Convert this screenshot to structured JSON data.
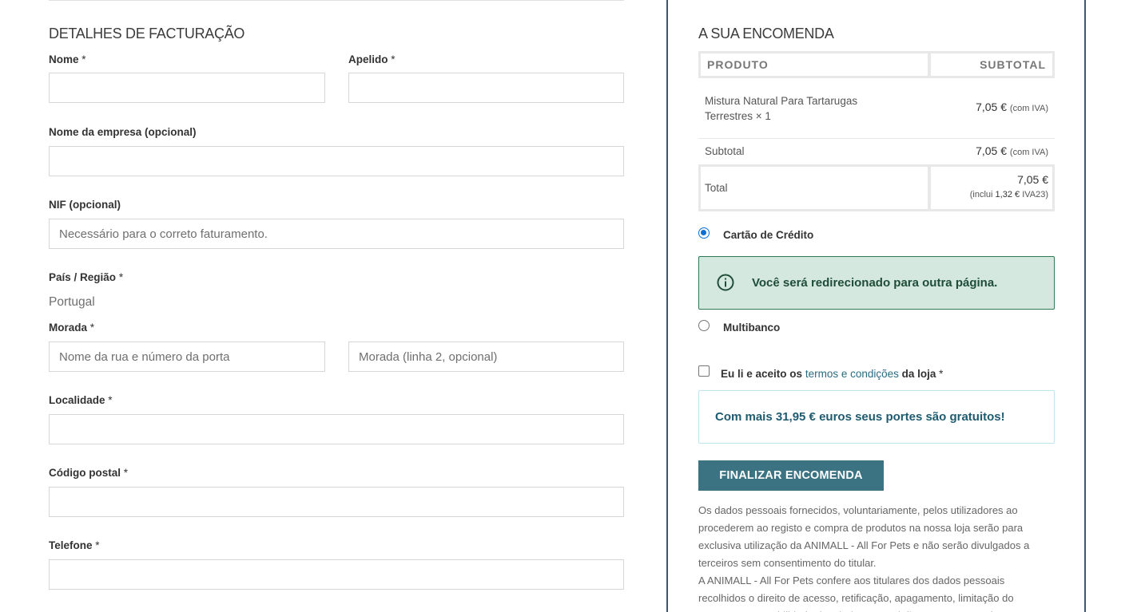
{
  "billing": {
    "title": "DETALHES DE FACTURAÇÃO",
    "required_mark": "*",
    "fields": {
      "first_name": {
        "label": "Nome",
        "value": "",
        "placeholder": ""
      },
      "last_name": {
        "label": "Apelido",
        "value": "",
        "placeholder": ""
      },
      "company": {
        "label": "Nome da empresa (opcional)",
        "value": "",
        "placeholder": ""
      },
      "nif": {
        "label": "NIF (opcional)",
        "value": "",
        "placeholder": "Necessário para o correto faturamento."
      },
      "country": {
        "label": "País / Região",
        "value": "Portugal"
      },
      "address1": {
        "label": "Morada",
        "value": "",
        "placeholder": "Nome da rua e número da porta"
      },
      "address2": {
        "value": "",
        "placeholder": "Morada (linha 2, opcional)"
      },
      "city": {
        "label": "Localidade",
        "value": "",
        "placeholder": ""
      },
      "postcode": {
        "label": "Código postal",
        "value": "",
        "placeholder": ""
      },
      "phone": {
        "label": "Telefone",
        "value": "",
        "placeholder": ""
      }
    }
  },
  "order": {
    "title": "A SUA ENCOMENDA",
    "table": {
      "headers": {
        "product": "PRODUTO",
        "subtotal": "SUBTOTAL"
      },
      "items": [
        {
          "name": "Mistura Natural Para Tartarugas Terrestres",
          "qty": "× 1",
          "price": "7,05 €",
          "tax_note": "(com IVA)"
        }
      ],
      "subtotal": {
        "label": "Subtotal",
        "price": "7,05 €",
        "tax_note": "(com IVA)"
      },
      "total": {
        "label": "Total",
        "price": "7,05 €",
        "incl_prefix": "(inclui",
        "incl_amount": "1,32 €",
        "incl_suffix": "IVA23)"
      }
    },
    "payment": {
      "methods": [
        {
          "label": "Cartão de Crédito",
          "selected": true
        },
        {
          "label": "Multibanco",
          "selected": false
        }
      ],
      "notice": "Você será redirecionado para outra página."
    },
    "terms": {
      "prefix": "Eu li e aceito os",
      "link": "termos e condições",
      "suffix": "da loja",
      "required_mark": "*",
      "checked": false
    },
    "shipping_notice": "Com mais 31,95 € euros seus portes são gratuitos!",
    "finalize_label": "FINALIZAR ENCOMENDA",
    "privacy": {
      "p1": "Os dados pessoais fornecidos, voluntariamente, pelos utilizadores ao procederem ao registo e compra de produtos na nossa loja serão para exclusiva utilização da ANIMALL - All For Pets e não serão divulgados a terceiros sem consentimento do titular.",
      "p2": "A ANIMALL - All For Pets confere aos titulares dos dados pessoais recolhidos o direito de acesso, retificação, apagamento, limitação do tratamento, portabilidade dos dados e oposição ao tratamento dos mesmos."
    }
  },
  "colors": {
    "order_border": "#3e5771",
    "button_bg": "#3b7383",
    "notice_green_bg": "#d4e8df",
    "notice_green_text": "#1e4d38",
    "link": "#2b6b82",
    "radio_selected": "#0b6fd6"
  },
  "icons": {
    "payment_notice": "info-circle-icon"
  }
}
